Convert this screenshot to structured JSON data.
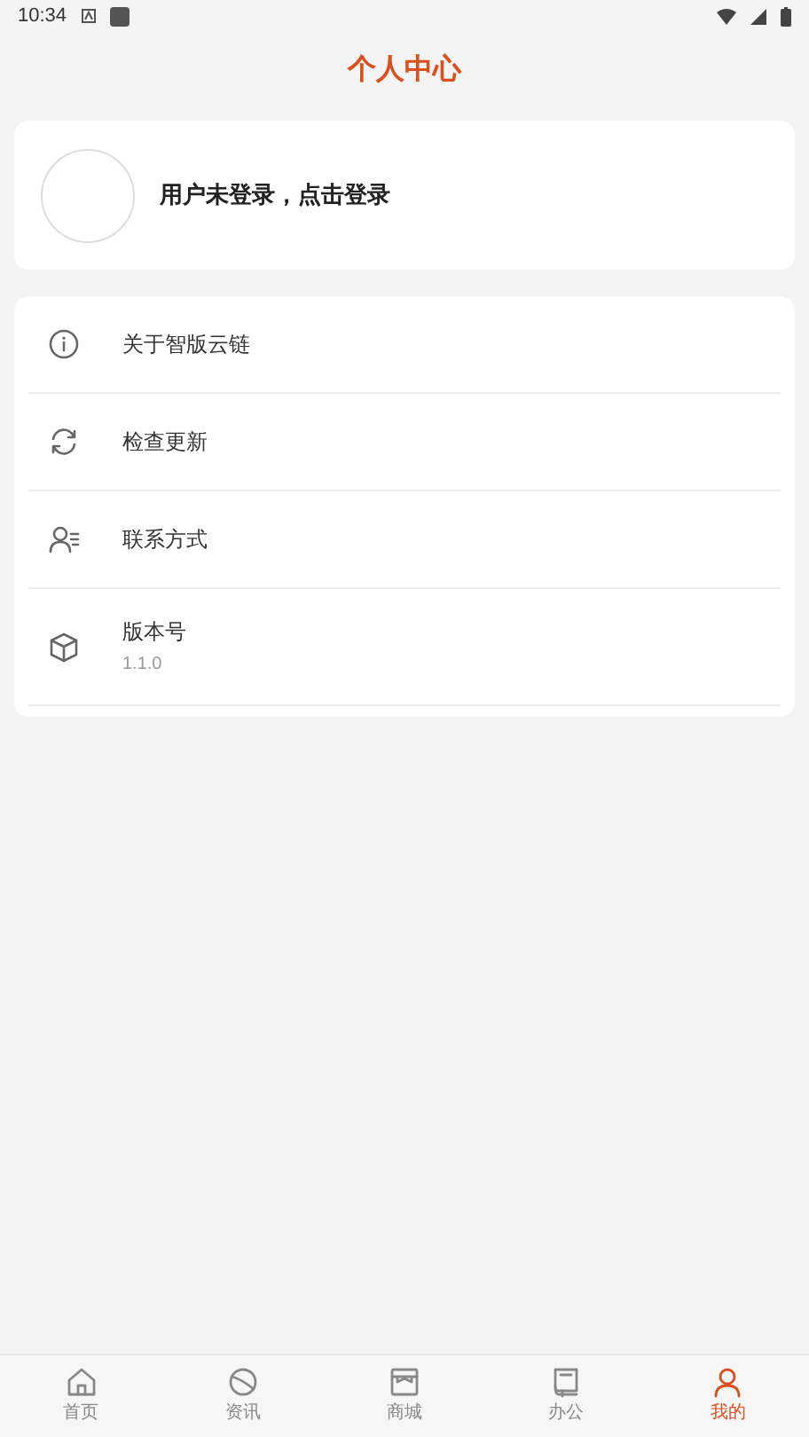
{
  "status_bar": {
    "time": "10:34"
  },
  "title": "个人中心",
  "profile": {
    "login_prompt": "用户未登录，点击登录"
  },
  "menu": [
    {
      "kind": "info",
      "label": "关于智版云链"
    },
    {
      "kind": "refresh",
      "label": "检查更新"
    },
    {
      "kind": "contact",
      "label": "联系方式"
    },
    {
      "kind": "box",
      "label": "版本号",
      "detail": "1.1.0"
    }
  ],
  "tabs": [
    {
      "kind": "home",
      "label": "首页",
      "selected": false
    },
    {
      "kind": "news",
      "label": "资讯",
      "selected": false
    },
    {
      "kind": "shop",
      "label": "商城",
      "selected": false
    },
    {
      "kind": "office",
      "label": "办公",
      "selected": false
    },
    {
      "kind": "me",
      "label": "我的",
      "selected": true
    }
  ]
}
